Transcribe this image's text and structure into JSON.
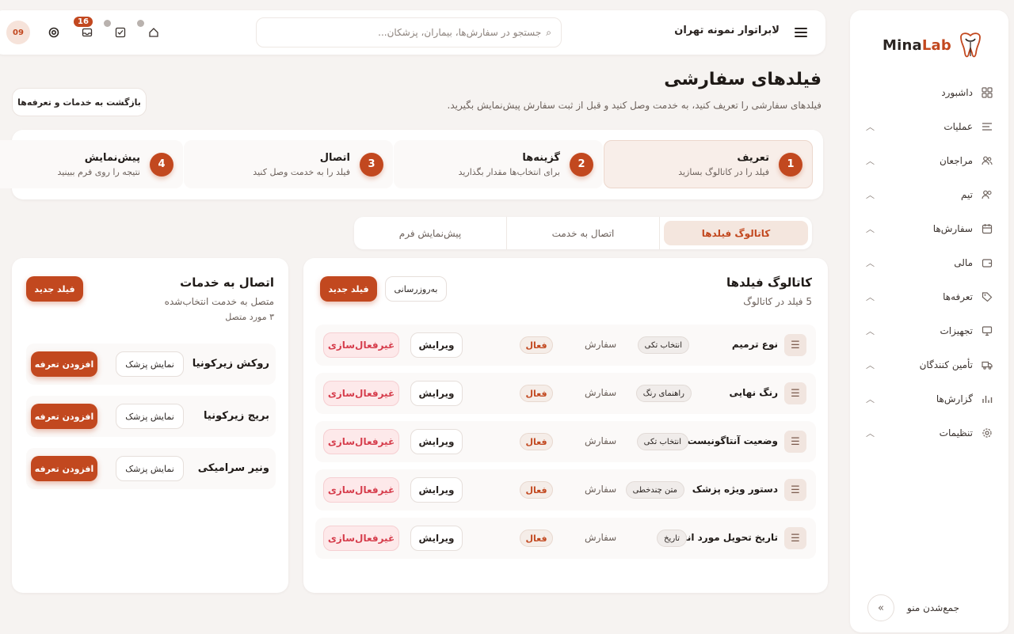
{
  "brand": {
    "name_part1": "Mina",
    "name_part2": "Lab"
  },
  "sidebar": {
    "items": [
      {
        "label": "داشبورد",
        "icon": "grid-icon",
        "chevron": false
      },
      {
        "label": "عملیات",
        "icon": "list-icon",
        "chevron": true
      },
      {
        "label": "مراجعان",
        "icon": "users-icon",
        "chevron": true
      },
      {
        "label": "تیم",
        "icon": "team-icon",
        "chevron": true
      },
      {
        "label": "سفارش‌ها",
        "icon": "calendar-icon",
        "chevron": true
      },
      {
        "label": "مالی",
        "icon": "wallet-icon",
        "chevron": true
      },
      {
        "label": "تعرفه‌ها",
        "icon": "tag-icon",
        "chevron": true
      },
      {
        "label": "تجهیزات",
        "icon": "monitor-icon",
        "chevron": true
      },
      {
        "label": "تأمین کنندگان",
        "icon": "truck-icon",
        "chevron": true
      },
      {
        "label": "گزارش‌ها",
        "icon": "chart-icon",
        "chevron": true
      },
      {
        "label": "تنظیمات",
        "icon": "gear-icon",
        "chevron": true
      }
    ],
    "collapse_label": "جمع‌شدن منو"
  },
  "header": {
    "title": "لابراتوار نمونه تهران",
    "search_placeholder": "جستجو در سفارش‌ها، بیماران، پزشکان...",
    "notification_count": "16",
    "avatar_initials": "09"
  },
  "page": {
    "title": "فیلدهای سفارشی",
    "subtitle": "فیلدهای سفارشی را تعریف کنید، به خدمت وصل کنید و قبل از ثبت سفارش پیش‌نمایش بگیرید.",
    "back_button": "بازگشت به خدمات و تعرفه‌ها"
  },
  "steps": [
    {
      "num": "1",
      "title": "تعریف",
      "desc": "فیلد را در کاتالوگ بسازید",
      "active": true
    },
    {
      "num": "2",
      "title": "گزینه‌ها",
      "desc": "برای انتخاب‌ها مقدار بگذارید",
      "active": false
    },
    {
      "num": "3",
      "title": "اتصال",
      "desc": "فیلد را به خدمت وصل کنید",
      "active": false
    },
    {
      "num": "4",
      "title": "پیش‌نمایش",
      "desc": "نتیجه را روی فرم ببینید",
      "active": false
    }
  ],
  "tabs": [
    {
      "label": "کاتالوگ فیلدها",
      "active": true
    },
    {
      "label": "اتصال به خدمت",
      "active": false
    },
    {
      "label": "پیش‌نمایش فرم",
      "active": false
    }
  ],
  "catalog": {
    "title": "کاتالوگ فیلدها",
    "count": "5 فیلد در کاتالوگ",
    "refresh_label": "به‌روزرسانی",
    "new_label": "فیلد جدید",
    "edit_label": "ویرایش",
    "deactivate_label": "غیرفعال‌سازی",
    "rows": [
      {
        "name": "نوع ترمیم",
        "type": "انتخاب تکی",
        "scope": "سفارش",
        "status": "فعال"
      },
      {
        "name": "رنگ نهایی",
        "type": "راهنمای رنگ",
        "scope": "سفارش",
        "status": "فعال"
      },
      {
        "name": "وضعیت آنتاگونیست",
        "type": "انتخاب تکی",
        "scope": "سفارش",
        "status": "فعال"
      },
      {
        "name": "دستور ویژه پزشک",
        "type": "متن چندخطی",
        "scope": "سفارش",
        "status": "فعال"
      },
      {
        "name": "تاریخ تحویل مورد انتظار",
        "type": "تاریخ",
        "scope": "سفارش",
        "status": "فعال"
      }
    ]
  },
  "connect": {
    "title": "اتصال به خدمات",
    "subtitle": "متصل به خدمت انتخاب‌شده",
    "count": "۳ مورد متصل",
    "new_label": "فیلد جدید",
    "show_label": "نمایش پزشک",
    "add_label": "افزودن تعرفه",
    "services": [
      {
        "name": "روکش زیرکونیا"
      },
      {
        "name": "بریج زیرکونیا"
      },
      {
        "name": "ونیر سرامیکی"
      }
    ]
  },
  "colors": {
    "accent": "#c2481f",
    "danger": "#d63d4c",
    "background": "#f6f3f1"
  }
}
